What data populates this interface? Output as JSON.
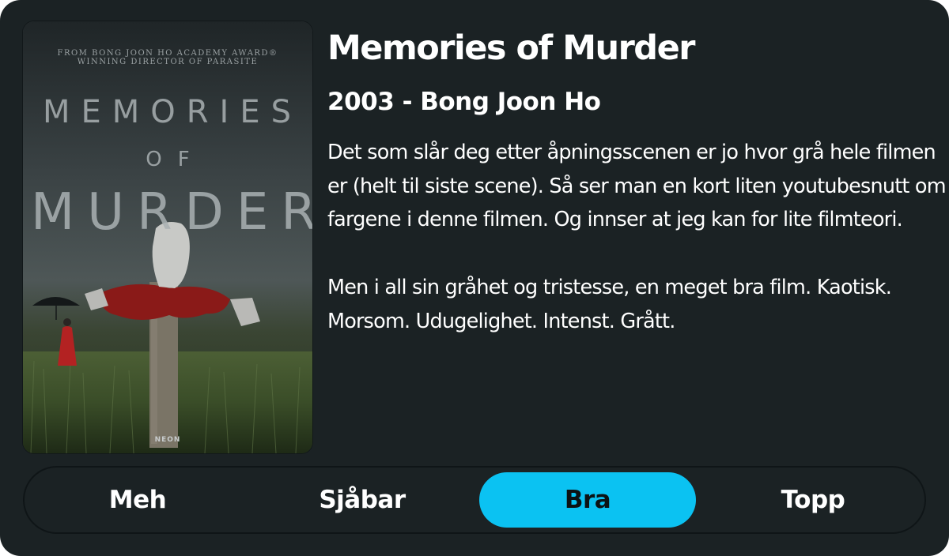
{
  "poster": {
    "credit_line1": "FROM BONG JOON HO ACADEMY AWARD®",
    "credit_line2": "WINNING DIRECTOR OF PARASITE",
    "title_line1": "MEMORIES",
    "title_line2": "OF",
    "title_line3": "MURDER",
    "studio": "NEON"
  },
  "movie": {
    "title": "Memories of Murder",
    "subtitle": "2003 - Bong Joon Ho",
    "review_paragraphs": [
      "Det som slår deg etter åpningsscenen er jo hvor grå hele filmen er (helt til siste scene). Så ser man en kort liten youtubesnutt om fargene i denne filmen. Og innser at jeg kan for lite filmteori.",
      "Men i all sin gråhet og tristesse, en meget bra film. Kaotisk. Morsom. Udugelighet. Intenst. Grått."
    ]
  },
  "rating": {
    "options": [
      "Meh",
      "Sjåbar",
      "Bra",
      "Topp"
    ],
    "selected": "Bra",
    "accent_color": "#0bc2f2"
  },
  "colors": {
    "background": "#1b2224",
    "text": "#ffffff"
  }
}
